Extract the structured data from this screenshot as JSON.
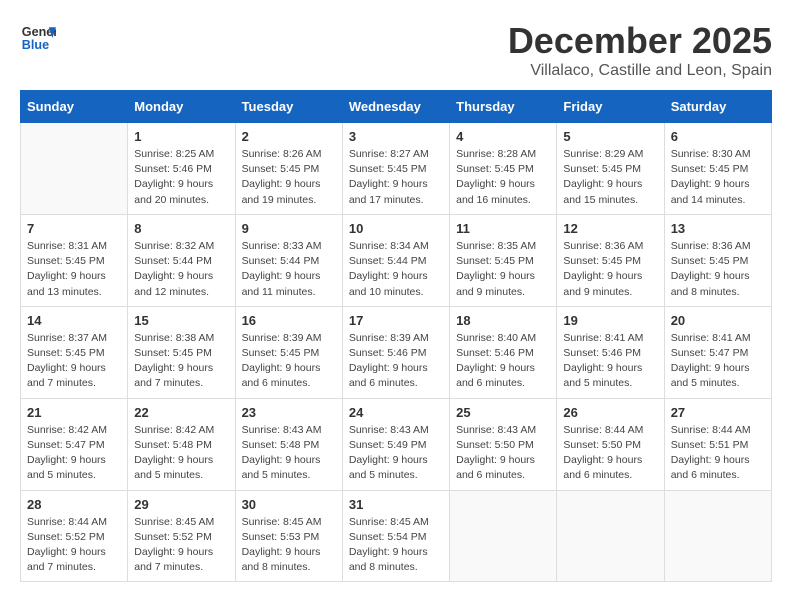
{
  "header": {
    "logo_line1": "General",
    "logo_line2": "Blue",
    "month": "December 2025",
    "location": "Villalaco, Castille and Leon, Spain"
  },
  "weekdays": [
    "Sunday",
    "Monday",
    "Tuesday",
    "Wednesday",
    "Thursday",
    "Friday",
    "Saturday"
  ],
  "weeks": [
    [
      {
        "day": "",
        "info": ""
      },
      {
        "day": "1",
        "info": "Sunrise: 8:25 AM\nSunset: 5:46 PM\nDaylight: 9 hours\nand 20 minutes."
      },
      {
        "day": "2",
        "info": "Sunrise: 8:26 AM\nSunset: 5:45 PM\nDaylight: 9 hours\nand 19 minutes."
      },
      {
        "day": "3",
        "info": "Sunrise: 8:27 AM\nSunset: 5:45 PM\nDaylight: 9 hours\nand 17 minutes."
      },
      {
        "day": "4",
        "info": "Sunrise: 8:28 AM\nSunset: 5:45 PM\nDaylight: 9 hours\nand 16 minutes."
      },
      {
        "day": "5",
        "info": "Sunrise: 8:29 AM\nSunset: 5:45 PM\nDaylight: 9 hours\nand 15 minutes."
      },
      {
        "day": "6",
        "info": "Sunrise: 8:30 AM\nSunset: 5:45 PM\nDaylight: 9 hours\nand 14 minutes."
      }
    ],
    [
      {
        "day": "7",
        "info": "Sunrise: 8:31 AM\nSunset: 5:45 PM\nDaylight: 9 hours\nand 13 minutes."
      },
      {
        "day": "8",
        "info": "Sunrise: 8:32 AM\nSunset: 5:44 PM\nDaylight: 9 hours\nand 12 minutes."
      },
      {
        "day": "9",
        "info": "Sunrise: 8:33 AM\nSunset: 5:44 PM\nDaylight: 9 hours\nand 11 minutes."
      },
      {
        "day": "10",
        "info": "Sunrise: 8:34 AM\nSunset: 5:44 PM\nDaylight: 9 hours\nand 10 minutes."
      },
      {
        "day": "11",
        "info": "Sunrise: 8:35 AM\nSunset: 5:45 PM\nDaylight: 9 hours\nand 9 minutes."
      },
      {
        "day": "12",
        "info": "Sunrise: 8:36 AM\nSunset: 5:45 PM\nDaylight: 9 hours\nand 9 minutes."
      },
      {
        "day": "13",
        "info": "Sunrise: 8:36 AM\nSunset: 5:45 PM\nDaylight: 9 hours\nand 8 minutes."
      }
    ],
    [
      {
        "day": "14",
        "info": "Sunrise: 8:37 AM\nSunset: 5:45 PM\nDaylight: 9 hours\nand 7 minutes."
      },
      {
        "day": "15",
        "info": "Sunrise: 8:38 AM\nSunset: 5:45 PM\nDaylight: 9 hours\nand 7 minutes."
      },
      {
        "day": "16",
        "info": "Sunrise: 8:39 AM\nSunset: 5:45 PM\nDaylight: 9 hours\nand 6 minutes."
      },
      {
        "day": "17",
        "info": "Sunrise: 8:39 AM\nSunset: 5:46 PM\nDaylight: 9 hours\nand 6 minutes."
      },
      {
        "day": "18",
        "info": "Sunrise: 8:40 AM\nSunset: 5:46 PM\nDaylight: 9 hours\nand 6 minutes."
      },
      {
        "day": "19",
        "info": "Sunrise: 8:41 AM\nSunset: 5:46 PM\nDaylight: 9 hours\nand 5 minutes."
      },
      {
        "day": "20",
        "info": "Sunrise: 8:41 AM\nSunset: 5:47 PM\nDaylight: 9 hours\nand 5 minutes."
      }
    ],
    [
      {
        "day": "21",
        "info": "Sunrise: 8:42 AM\nSunset: 5:47 PM\nDaylight: 9 hours\nand 5 minutes."
      },
      {
        "day": "22",
        "info": "Sunrise: 8:42 AM\nSunset: 5:48 PM\nDaylight: 9 hours\nand 5 minutes."
      },
      {
        "day": "23",
        "info": "Sunrise: 8:43 AM\nSunset: 5:48 PM\nDaylight: 9 hours\nand 5 minutes."
      },
      {
        "day": "24",
        "info": "Sunrise: 8:43 AM\nSunset: 5:49 PM\nDaylight: 9 hours\nand 5 minutes."
      },
      {
        "day": "25",
        "info": "Sunrise: 8:43 AM\nSunset: 5:50 PM\nDaylight: 9 hours\nand 6 minutes."
      },
      {
        "day": "26",
        "info": "Sunrise: 8:44 AM\nSunset: 5:50 PM\nDaylight: 9 hours\nand 6 minutes."
      },
      {
        "day": "27",
        "info": "Sunrise: 8:44 AM\nSunset: 5:51 PM\nDaylight: 9 hours\nand 6 minutes."
      }
    ],
    [
      {
        "day": "28",
        "info": "Sunrise: 8:44 AM\nSunset: 5:52 PM\nDaylight: 9 hours\nand 7 minutes."
      },
      {
        "day": "29",
        "info": "Sunrise: 8:45 AM\nSunset: 5:52 PM\nDaylight: 9 hours\nand 7 minutes."
      },
      {
        "day": "30",
        "info": "Sunrise: 8:45 AM\nSunset: 5:53 PM\nDaylight: 9 hours\nand 8 minutes."
      },
      {
        "day": "31",
        "info": "Sunrise: 8:45 AM\nSunset: 5:54 PM\nDaylight: 9 hours\nand 8 minutes."
      },
      {
        "day": "",
        "info": ""
      },
      {
        "day": "",
        "info": ""
      },
      {
        "day": "",
        "info": ""
      }
    ]
  ]
}
